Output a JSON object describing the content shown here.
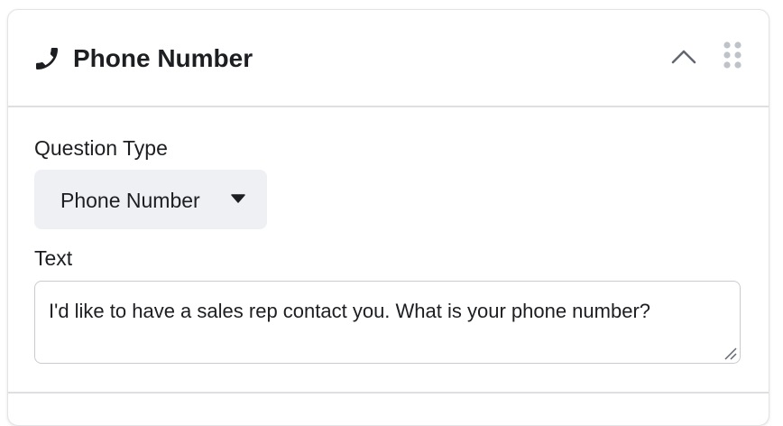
{
  "header": {
    "icon": "phone-icon",
    "title": "Phone Number",
    "collapse_icon": "chevron-up-icon",
    "drag_icon": "drag-handle-icon"
  },
  "form": {
    "question_type": {
      "label": "Question Type",
      "value": "Phone Number",
      "icon": "caret-down-icon"
    },
    "text": {
      "label": "Text",
      "value": "I'd like to have a sales rep contact you. What is your phone number?",
      "icon": "resize-handle-icon"
    }
  },
  "colors": {
    "border": "#dddfe2",
    "select_bg": "#eef0f3",
    "text": "#1c1e21",
    "icon_gray": "#8d949e"
  }
}
